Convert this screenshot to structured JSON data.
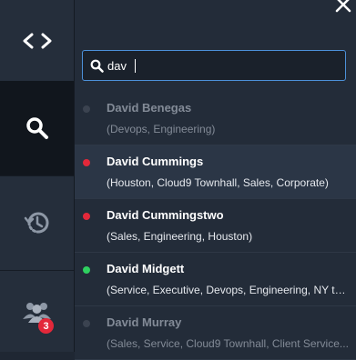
{
  "sidebar": {
    "items": [
      {
        "icon": "code-brackets-icon",
        "active": false
      },
      {
        "icon": "search-icon",
        "active": true
      },
      {
        "icon": "history-icon",
        "active": false
      },
      {
        "icon": "people-icon",
        "active": false,
        "badge": "3"
      }
    ]
  },
  "search": {
    "value": "dav"
  },
  "colors": {
    "online": "#e3283a",
    "available": "#2fd160",
    "offline": "#3b4350",
    "badge": "#e3283a",
    "focus": "#4c90d9"
  },
  "results": [
    {
      "name": "David Benegas",
      "groups": "(Devops, Engineering)",
      "status": "offline"
    },
    {
      "name": "David Cummings",
      "groups": "(Houston, Cloud9 Townhall, Sales, Corporate)",
      "status": "online"
    },
    {
      "name": "David Cummingstwo",
      "groups": "(Sales, Engineering, Houston)",
      "status": "online"
    },
    {
      "name": "David Midgett",
      "groups": "(Service, Executive, Devops, Engineering, NY to...",
      "status": "available"
    },
    {
      "name": "David Murray",
      "groups": "(Sales, Service, Cloud9 Townhall, Client Service...",
      "status": "offline"
    }
  ]
}
